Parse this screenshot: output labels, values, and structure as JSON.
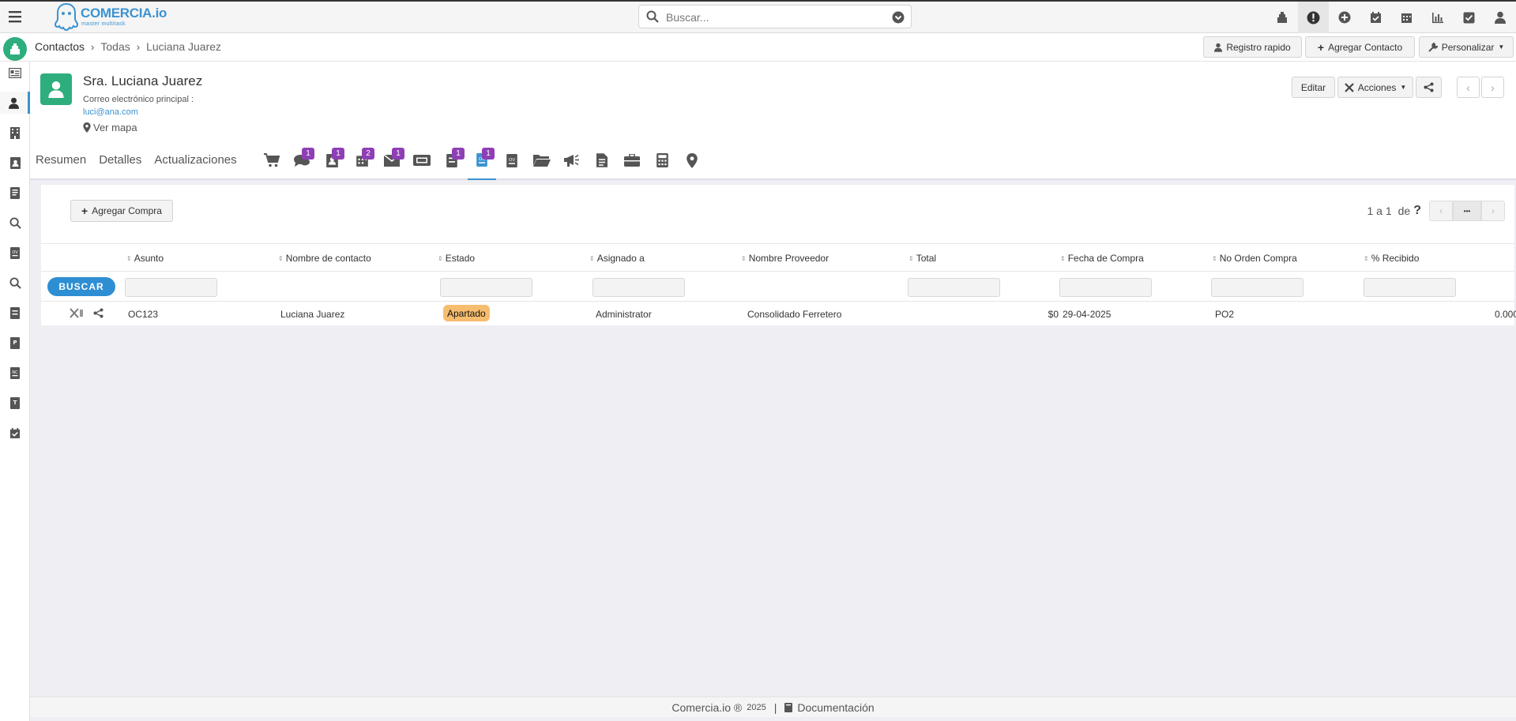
{
  "app": {
    "logo_main": "COMERCIA.io",
    "logo_sub": "master multitask",
    "search_placeholder": "Buscar...",
    "top_icons": [
      "cash-register-icon",
      "alert-icon",
      "plus-circle-icon",
      "calendar-check-icon",
      "calendar-icon",
      "bar-chart-icon",
      "checkbox-icon",
      "user-icon"
    ]
  },
  "breadcrumb": {
    "module": "Contactos",
    "list": "Todas",
    "record": "Luciana Juarez"
  },
  "toolbar": {
    "quick_register": "Registro rapido",
    "add_contact": "Agregar Contacto",
    "customize": "Personalizar"
  },
  "contact": {
    "name": "Sra. Luciana Juarez",
    "email_label": "Correo electrónico principal :",
    "email": "luci@ana.com",
    "map_link": "Ver mapa"
  },
  "actions": {
    "edit": "Editar",
    "actions": "Acciones"
  },
  "tabs": {
    "summary": "Resumen",
    "details": "Detalles",
    "updates": "Actualizaciones"
  },
  "tab_badges": {
    "conversations": "1",
    "contacts": "1",
    "calendar": "2",
    "emails": "1",
    "invoices": "1",
    "purchase_orders": "1"
  },
  "subpanel": {
    "add_button": "Agregar Compra",
    "pager_text": "1 a 1",
    "pager_of": "de",
    "pager_more": "•••",
    "search_button": "BUSCAR",
    "columns": [
      "Asunto",
      "Nombre de contacto",
      "Estado",
      "Asignado a",
      "Nombre Proveedor",
      "Total",
      "Fecha de Compra",
      "No Orden Compra",
      "% Recibido"
    ],
    "rows": [
      {
        "subject": "OC123",
        "contact": "Luciana Juarez",
        "status": "Apartado",
        "assigned": "Administrator",
        "supplier": "Consolidado Ferretero",
        "total": "$0",
        "date": "29-04-2025",
        "order_no": "PO2",
        "received": "0.000"
      }
    ]
  },
  "footer": {
    "brand": "Comercia.io ®",
    "year": "2025",
    "separator": "|",
    "docs": "Documentación"
  },
  "colors": {
    "accent": "#3b93d1",
    "brand_green": "#2ead7d",
    "badge": "#8e3fb5",
    "status_apartado": "#f6bd6f"
  }
}
